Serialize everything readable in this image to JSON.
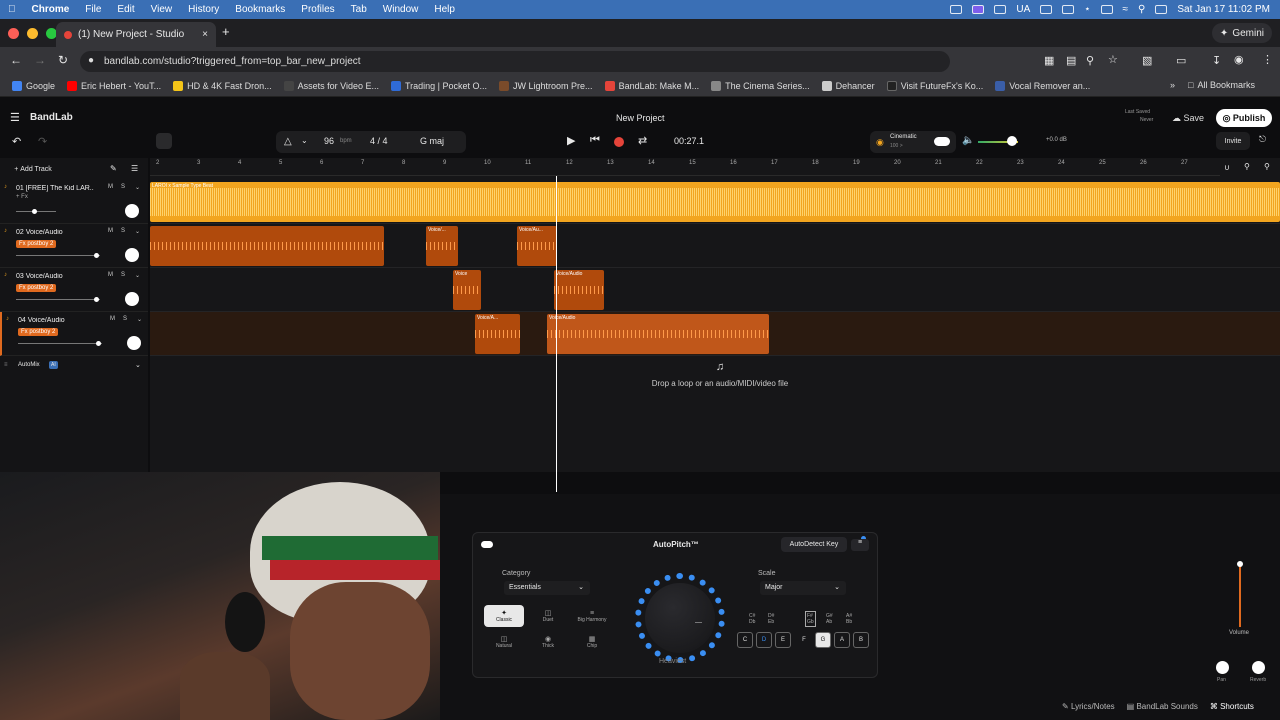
{
  "menubar": {
    "apple": "",
    "items": [
      "Chrome",
      "File",
      "Edit",
      "View",
      "History",
      "Bookmarks",
      "Profiles",
      "Tab",
      "Window",
      "Help"
    ],
    "lang": "UA",
    "datetime": "Sat Jan 17  11:02 PM"
  },
  "browser": {
    "tab_title": "(1) New Project - Studio",
    "new_tab": "+",
    "gemini": "Gemini",
    "url": "bandlab.com/studio?triggered_from=top_bar_new_project",
    "bookmarks": [
      {
        "label": "Google",
        "color": "#4285f4"
      },
      {
        "label": "Eric Hebert - YouT...",
        "color": "#ff0000"
      },
      {
        "label": "HD & 4K Fast Dron...",
        "color": "#f5c518"
      },
      {
        "label": "Assets for Video E...",
        "color": "#444"
      },
      {
        "label": "Trading | Pocket O...",
        "color": "#2f6bd8"
      },
      {
        "label": "JW Lightroom Pre...",
        "color": "#7a4b2a"
      },
      {
        "label": "BandLab: Make M...",
        "color": "#e5443a"
      },
      {
        "label": "The Cinema Series...",
        "color": "#888"
      },
      {
        "label": "Dehancer",
        "color": "#ccc"
      },
      {
        "label": "Visit FutureFx's Ko...",
        "color": "#222"
      },
      {
        "label": "Vocal Remover an...",
        "color": "#3a5ea8"
      }
    ],
    "all_bookmarks": "All Bookmarks"
  },
  "bandlab": {
    "logo": "BandLab",
    "project_title": "New Project",
    "last_saved_label": "Last Saved",
    "last_saved_value": "Never",
    "save": "Save",
    "publish": "Publish",
    "invite": "Invite",
    "bpm": "96",
    "bpm_unit": "bpm",
    "time_sig": "4 / 4",
    "key": "G maj",
    "time": "00:27.1",
    "cinematic": "Cinematic",
    "cinematic_sub": "100 >",
    "db": "+0.0 dB",
    "add_track": "Add Track",
    "drop_hint": "Drop a loop or an audio/MIDI/video file",
    "automix": "AutoMix",
    "automix_badge": "AI"
  },
  "ruler": [
    "2",
    "3",
    "4",
    "5",
    "6",
    "7",
    "8",
    "9",
    "10",
    "11",
    "12",
    "13",
    "14",
    "15",
    "16",
    "17",
    "18",
    "19",
    "20",
    "21",
    "22",
    "23",
    "24",
    "25",
    "26",
    "27"
  ],
  "tracks": [
    {
      "name": "01  [FREE] The Kid LAR...",
      "fx": "+ Fx",
      "m": "M",
      "s": "S",
      "volume": 0.45,
      "clips": [
        {
          "label": "LAROI x Sample Type Beat",
          "start": 0,
          "width": 1130,
          "color": "#f2a51f"
        }
      ]
    },
    {
      "name": "02  Voice/Audio",
      "fx": "Fx  postboy 2",
      "m": "M",
      "s": "S",
      "volume": 0.95,
      "clips": [
        {
          "label": "",
          "start": 0,
          "width": 234,
          "color": "#b04a0c"
        },
        {
          "label": "Voice/...",
          "start": 276,
          "width": 32,
          "color": "#b04a0c"
        },
        {
          "label": "Voice/Au...",
          "start": 367,
          "width": 40,
          "color": "#b04a0c"
        }
      ]
    },
    {
      "name": "03  Voice/Audio",
      "fx": "Fx  postboy 2",
      "m": "M",
      "s": "S",
      "volume": 0.95,
      "clips": [
        {
          "label": "Voice",
          "start": 303,
          "width": 28,
          "color": "#b04a0c"
        },
        {
          "label": "Voice/Audio",
          "start": 404,
          "width": 50,
          "color": "#b04a0c"
        }
      ]
    },
    {
      "name": "04  Voice/Audio",
      "fx": "Fx  postboy 2",
      "m": "M",
      "s": "S",
      "volume": 0.95,
      "clips": [
        {
          "label": "Voice/A...",
          "start": 325,
          "width": 45,
          "color": "#b04a0c"
        },
        {
          "label": "Voice/Audio",
          "start": 397,
          "width": 222,
          "color": "#c0571a"
        }
      ]
    }
  ],
  "autopitch": {
    "title": "AutoPitch™",
    "autodetect": "AutoDetect Key",
    "category_label": "Category",
    "category_value": "Essentials",
    "scale_label": "Scale",
    "scale_value": "Major",
    "modes": [
      "Classic",
      "Duet",
      "Big Harmony",
      "Natural",
      "Thick",
      "Chip"
    ],
    "knob_label": "Heaviest",
    "sharps": [
      "C#\nDb",
      "D#\nEb",
      "F#\nGb",
      "G#\nAb",
      "A#\nBb"
    ],
    "keys": [
      "C",
      "D",
      "E",
      "F",
      "G",
      "A",
      "B"
    ],
    "volume_label": "Volume",
    "pan_label": "Pan",
    "reverb_label": "Reverb"
  },
  "bottom": {
    "lyrics": "Lyrics/Notes",
    "sounds": "BandLab Sounds",
    "shortcuts": "Shortcuts"
  }
}
